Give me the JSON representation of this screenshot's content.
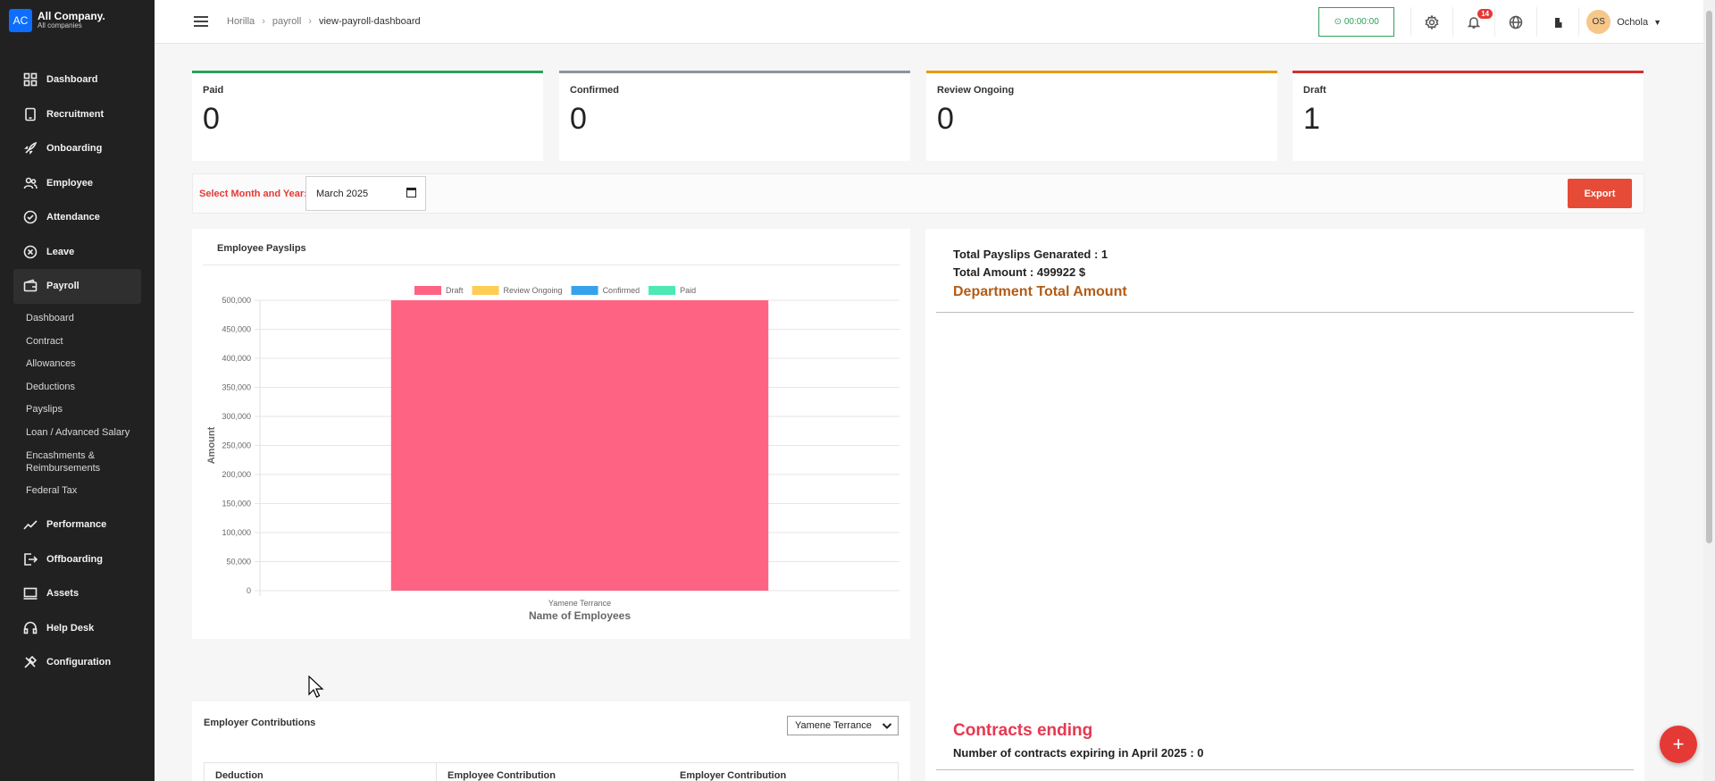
{
  "company": {
    "logo": "AC",
    "name": "All Company.",
    "sub": "All companies"
  },
  "nav": [
    {
      "label": "Dashboard",
      "icon": "dashboard-icon"
    },
    {
      "label": "Recruitment",
      "icon": "recruitment-icon"
    },
    {
      "label": "Onboarding",
      "icon": "onboarding-icon"
    },
    {
      "label": "Employee",
      "icon": "employee-icon"
    },
    {
      "label": "Attendance",
      "icon": "attendance-icon"
    },
    {
      "label": "Leave",
      "icon": "leave-icon"
    },
    {
      "label": "Payroll",
      "icon": "payroll-icon"
    },
    {
      "label": "Performance",
      "icon": "performance-icon"
    },
    {
      "label": "Offboarding",
      "icon": "offboarding-icon"
    },
    {
      "label": "Assets",
      "icon": "assets-icon"
    },
    {
      "label": "Help Desk",
      "icon": "helpdesk-icon"
    },
    {
      "label": "Configuration",
      "icon": "configuration-icon"
    }
  ],
  "payroll_sub": [
    "Dashboard",
    "Contract",
    "Allowances",
    "Deductions",
    "Payslips",
    "Loan / Advanced Salary",
    "Encashments & Reimbursements",
    "Federal Tax"
  ],
  "breadcrumb": {
    "a": "Horilla",
    "b": "payroll",
    "c": "view-payroll-dashboard"
  },
  "topbar": {
    "timer": "⊙ 00:00:00",
    "notif_count": "14",
    "user_initials": "OS",
    "user_name": "Ochola"
  },
  "cards": [
    {
      "label": "Paid",
      "value": "0",
      "color": "#2ea05a"
    },
    {
      "label": "Confirmed",
      "value": "0",
      "color": "#8c959d"
    },
    {
      "label": "Review Ongoing",
      "value": "0",
      "color": "#e39d14"
    },
    {
      "label": "Draft",
      "value": "1",
      "color": "#d32f2f"
    }
  ],
  "filter": {
    "label": "Select Month and Year:",
    "value": "March 2025",
    "export": "Export"
  },
  "chart_panel": {
    "title": "Employee Payslips"
  },
  "chart_data": {
    "type": "bar",
    "categories": [
      "Yamene Terrance"
    ],
    "series": [
      {
        "name": "Draft",
        "values": [
          499922
        ],
        "color": "#ff6384"
      },
      {
        "name": "Review Ongoing",
        "values": [
          0
        ],
        "color": "#ffcd56"
      },
      {
        "name": "Confirmed",
        "values": [
          0
        ],
        "color": "#36a2eb"
      },
      {
        "name": "Paid",
        "values": [
          0
        ],
        "color": "#4ee8b4"
      }
    ],
    "xlabel": "Name of Employees",
    "ylabel": "Amount",
    "ylim": [
      0,
      500000
    ],
    "yticks": [
      "500,000",
      "450,000",
      "400,000",
      "350,000",
      "300,000",
      "250,000",
      "200,000",
      "150,000",
      "100,000",
      "50,000",
      "0"
    ],
    "legend": "top",
    "grid": true
  },
  "right_panel": {
    "total_payslips": "Total Payslips Genarated : 1",
    "total_amount": "Total Amount : 499922 $",
    "dept_title": "Department Total Amount",
    "contracts_title": "Contracts ending",
    "contracts_sub": "Number of contracts expiring in April 2025 : 0"
  },
  "contrib": {
    "title": "Employer Contributions",
    "employee": "Yamene Terrance",
    "columns": [
      "Deduction",
      "Employee Contribution",
      "Employer Contribution"
    ]
  }
}
